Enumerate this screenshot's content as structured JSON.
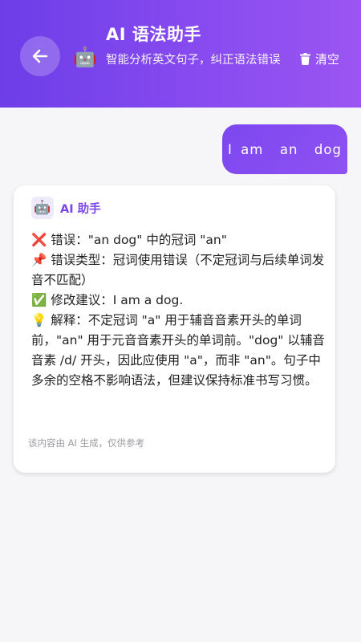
{
  "header": {
    "title": "AI 语法助手",
    "subtitle": "智能分析英文句子，纠正语法错误",
    "clear_label": "清空",
    "back_icon": "arrow-left-icon",
    "avatar_icon": "robot-icon",
    "clear_icon": "trash-icon"
  },
  "messages": {
    "user_text": "I am  an  dog",
    "ai": {
      "name": "AI 助手",
      "lines": {
        "error": "❌ 错误：\"an dog\" 中的冠词 \"an\"",
        "type": "📌 错误类型：冠词使用错误（不定冠词与后续单词发音不匹配）",
        "suggestion": "✅ 修改建议：I am a dog.",
        "explanation": "💡 解释：不定冠词 \"a\" 用于辅音音素开头的单词前，\"an\" 用于元音音素开头的单词前。\"dog\" 以辅音音素 /d/ 开头，因此应使用 \"a\"，而非 \"an\"。句子中多余的空格不影响语法，但建议保持标准书写习惯。"
      },
      "disclaimer": "该内容由 AI 生成，仅供参考"
    }
  },
  "colors": {
    "accent": "#7c47ef",
    "header_start": "#6d3de8",
    "header_end": "#9b55f2"
  }
}
